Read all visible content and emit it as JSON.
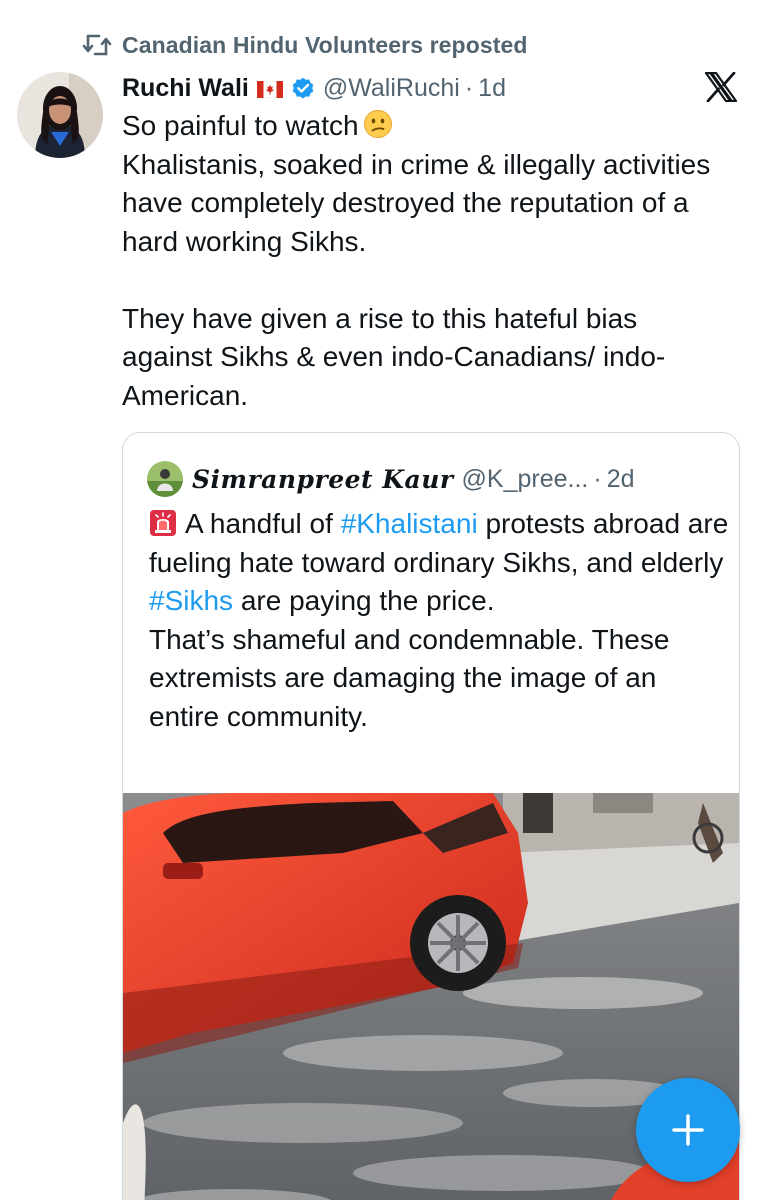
{
  "repost": {
    "label": "Canadian Hindu Volunteers reposted",
    "icon": "repost-icon"
  },
  "tweet": {
    "author_name": "Ruchi Wali",
    "author_flag": "canada-flag-icon",
    "verified_icon": "verified-badge-icon",
    "handle": "@WaliRuchi",
    "separator": "·",
    "time": "1d",
    "line1": "So painful to watch",
    "line1_emoji": "confused-face-icon",
    "paragraph1": "Khalistanis, soaked in crime & illegally activities have completely destroyed the reputation of a hard working Sikhs.",
    "paragraph2": "They have given a rise to this hateful bias against Sikhs & even indo-Canadians/ indo-American."
  },
  "quote": {
    "author_name": "Simranpreet Kaur",
    "handle": "@K_pree...",
    "separator": "·",
    "time": "2d",
    "siren_icon": "siren-icon",
    "text_a": "A handful of ",
    "hashtag_1": "#Khalistani",
    "text_b": " protests abroad are fueling hate toward  ordinary Sikhs, and elderly ",
    "hashtag_2": "#Sikhs",
    "text_c": " are paying the price.",
    "text_d": "That’s shameful and condemnable. These extremists are damaging the image of an entire community."
  },
  "media": {
    "description_icon": "video-thumbnail"
  },
  "fab": {
    "icon": "plus-icon"
  },
  "colors": {
    "text_primary": "#0f1419",
    "text_secondary": "#536471",
    "link": "#1d9bf0",
    "border": "#cfd9de",
    "fab": "#1d9bf0",
    "verified": "#1d9bf0"
  }
}
